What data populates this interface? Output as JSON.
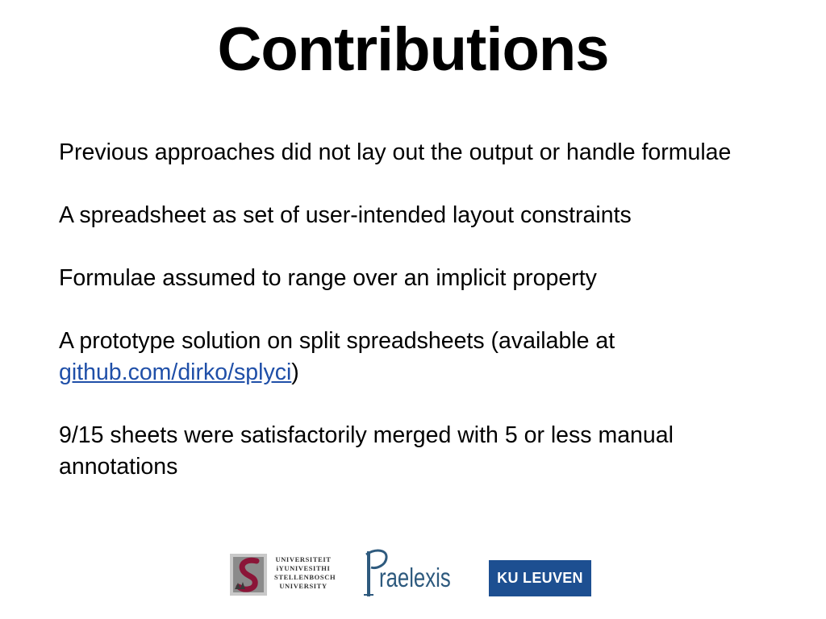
{
  "slide": {
    "title": "Contributions",
    "points": [
      "Previous approaches did not lay out the output or handle formulae",
      "A spreadsheet as set of user-intended layout constraints",
      "Formulae assumed to range over an implicit property"
    ],
    "prototype": {
      "text_before": "A prototype solution on split spreadsheets (available at ",
      "link_text": "github.com/dirko/splyci",
      "text_after": ")"
    },
    "results": "9/15 sheets were satisfactorily merged with 5 or less manual annotations",
    "link_color": "#1f4fa8"
  },
  "logos": {
    "stellenbosch": {
      "lines": [
        "UNIVERSITEIT",
        "iYUNIVESITHI",
        "STELLENBOSCH",
        "UNIVERSITY"
      ],
      "color": "#8b1538"
    },
    "praelexis": {
      "text": "raelexis",
      "color": "#2e5a7e"
    },
    "kuleuven": {
      "text": "KU LEUVEN",
      "color": "#1d4f91"
    }
  }
}
